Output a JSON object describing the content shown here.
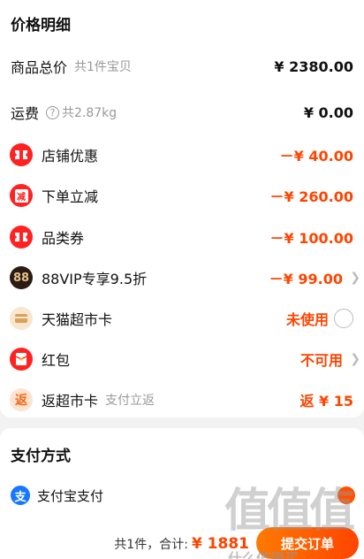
{
  "price_detail": {
    "title": "价格明细",
    "goods_total": {
      "label": "商品总价",
      "sub": "共1件宝贝",
      "amount": "¥ 2380.00"
    },
    "shipping": {
      "label": "运费",
      "info_icon": "?",
      "sub": "共2.87kg",
      "amount": "¥ 0.00"
    },
    "store_discount": {
      "label": "店铺优惠",
      "amount": "－¥ 40.00"
    },
    "order_discount": {
      "label": "下单立减",
      "icon_text": "减",
      "amount": "－¥ 260.00"
    },
    "category_coupon": {
      "label": "品类券",
      "amount": "－¥ 100.00"
    },
    "vip_discount": {
      "label": "88VIP专享9.5折",
      "icon_text": "88",
      "amount": "－¥ 99.00"
    },
    "tmall_card": {
      "label": "天猫超市卡",
      "status": "未使用"
    },
    "red_packet": {
      "label": "红包",
      "status": "不可用"
    },
    "cashback_card": {
      "label": "返超市卡",
      "icon_text": "返",
      "sub": "支付立返",
      "amount": "返 ¥ 15"
    }
  },
  "payment": {
    "title": "支付方式",
    "method": {
      "icon_text": "支",
      "label": "支付宝支付"
    }
  },
  "bottom": {
    "count": "共1件，",
    "total_label": "合计:",
    "total_value": "¥ 1881",
    "submit_label": "提交订单"
  },
  "watermark": {
    "chars": "值值值",
    "site": "什么值得买"
  },
  "colors": {
    "accent": "#ff4400",
    "coupon_red": "#ff2222",
    "alipay_blue": "#1677ff"
  }
}
